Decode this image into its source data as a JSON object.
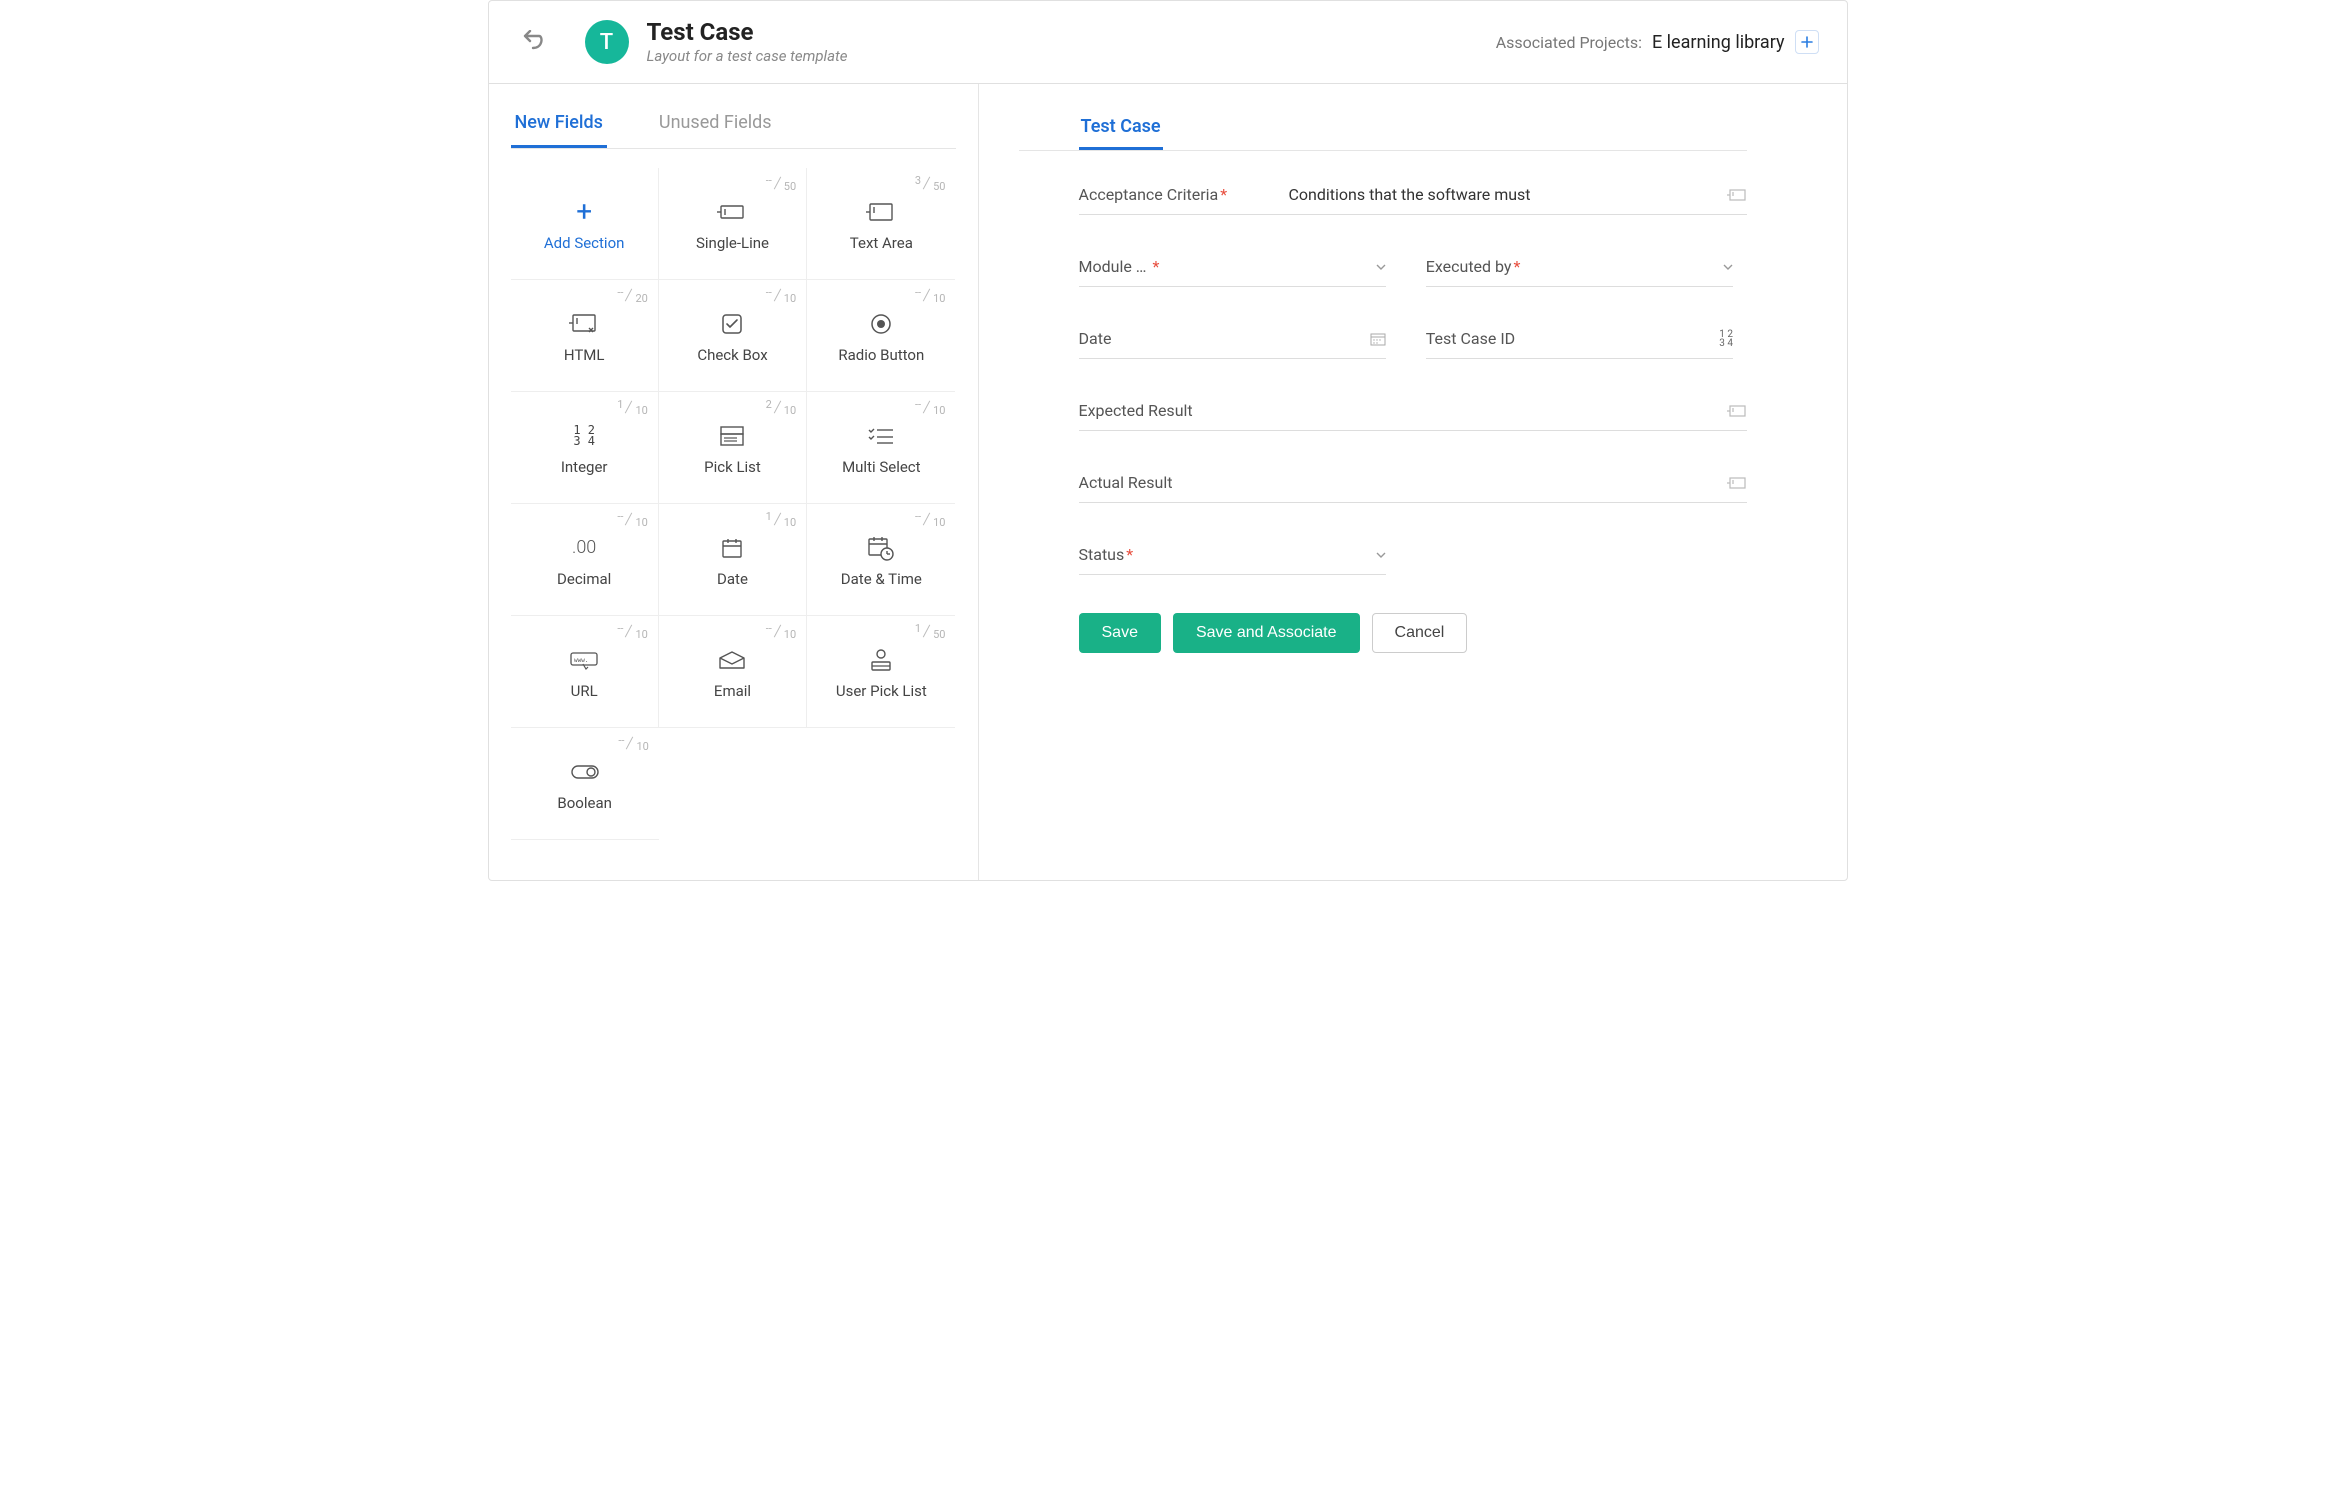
{
  "header": {
    "avatar_letter": "T",
    "title": "Test Case",
    "subtitle": "Layout for a test case template",
    "associated_label": "Associated Projects:",
    "associated_project": "E learning library"
  },
  "left_panel": {
    "tabs": [
      "New Fields",
      "Unused Fields"
    ],
    "active_tab": 0,
    "add_section_label": "Add Section",
    "field_types": [
      {
        "name": "Single-Line",
        "used": "--",
        "max": "50"
      },
      {
        "name": "Text Area",
        "used": "3",
        "max": "50"
      },
      {
        "name": "HTML",
        "used": "--",
        "max": "20"
      },
      {
        "name": "Check Box",
        "used": "--",
        "max": "10"
      },
      {
        "name": "Radio Button",
        "used": "--",
        "max": "10"
      },
      {
        "name": "Integer",
        "used": "1",
        "max": "10"
      },
      {
        "name": "Pick List",
        "used": "2",
        "max": "10"
      },
      {
        "name": "Multi Select",
        "used": "--",
        "max": "10"
      },
      {
        "name": "Decimal",
        "used": "--",
        "max": "10"
      },
      {
        "name": "Date",
        "used": "1",
        "max": "10"
      },
      {
        "name": "Date & Time",
        "used": "--",
        "max": "10"
      },
      {
        "name": "URL",
        "used": "--",
        "max": "10"
      },
      {
        "name": "Email",
        "used": "--",
        "max": "10"
      },
      {
        "name": "User Pick List",
        "used": "1",
        "max": "50"
      },
      {
        "name": "Boolean",
        "used": "--",
        "max": "10"
      }
    ]
  },
  "right_panel": {
    "section_title": "Test Case",
    "fields": {
      "acceptance_criteria": {
        "label": "Acceptance Criteria",
        "required": true,
        "value": "Conditions that the software must",
        "type": "textarea"
      },
      "module": {
        "label": "Module …",
        "required": true,
        "type": "picklist"
      },
      "executed_by": {
        "label": "Executed by",
        "required": true,
        "type": "picklist"
      },
      "date": {
        "label": "Date",
        "type": "date"
      },
      "test_case_id": {
        "label": "Test Case ID",
        "type": "integer"
      },
      "expected": {
        "label": "Expected Result",
        "type": "textarea"
      },
      "actual": {
        "label": "Actual Result",
        "type": "textarea"
      },
      "status": {
        "label": "Status",
        "required": true,
        "type": "picklist"
      }
    },
    "buttons": {
      "save": "Save",
      "save_assoc": "Save and Associate",
      "cancel": "Cancel"
    }
  }
}
